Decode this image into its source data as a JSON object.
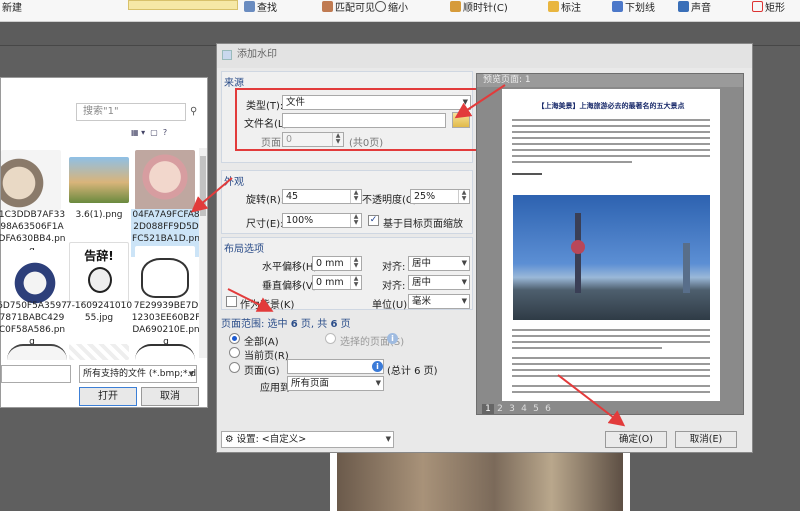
{
  "toolbar": {
    "items": [
      "新建",
      "查找",
      "匹配可见",
      "缩小",
      "顺时针(C)",
      "标注",
      "下划线",
      "声音",
      "矩形"
    ]
  },
  "file_dialog": {
    "search_placeholder": "搜索\"1\"",
    "files": [
      {
        "name": "1C3DDB7AF3398A63506F1ADFA630BB4.png",
        "thumb": "totoro"
      },
      {
        "name": "3.6(1).png",
        "thumb": "dog"
      },
      {
        "name": "04FA7A9FCFA82D088FF9D5DFC521BA1D.png",
        "thumb": "cat"
      },
      {
        "name": "6D750F5A35977871BABC429C0F58A586.png",
        "thumb": "penguin"
      },
      {
        "name": "7-160924101055.jpg",
        "thumb": "meme"
      },
      {
        "name": "7E29939BE7D12303EE60B2FDA690210E.png",
        "thumb": "whitecat"
      }
    ],
    "meme_text": "告辞!",
    "file_type": "所有支持的文件 (*.bmp;*.dib;*",
    "open_button": "打开",
    "cancel_button": "取消"
  },
  "main_dialog": {
    "title": "添加水印",
    "source": {
      "group_title": "来源",
      "type_label": "类型(T):",
      "type_value": "文件",
      "filename_label": "文件名(L):",
      "filename_value": "",
      "page_label": "页面:",
      "page_value": "0",
      "page_total": "(共0页)"
    },
    "appearance": {
      "group_title": "外观",
      "rotation_label": "旋转(R):",
      "rotation_value": "45",
      "opacity_label": "不透明度(C):",
      "opacity_value": "25%",
      "size_label": "尺寸(E):",
      "size_value": "100%",
      "scale_label": "基于目标页面缩放"
    },
    "layout": {
      "group_title": "布局选项",
      "h_offset_label": "水平偏移(H):",
      "h_offset_value": "0 mm",
      "h_align_label": "对齐:",
      "h_align_value": "居中",
      "v_offset_label": "垂直偏移(V):",
      "v_offset_value": "0 mm",
      "v_align_label": "对齐:",
      "v_align_value": "居中",
      "background_label": "作为背景(K)",
      "unit_label": "单位(U):",
      "unit_value": "毫米"
    },
    "page_range": {
      "title_prefix": "页面范围: 选中",
      "selected_count": "6",
      "title_mid": "页, 共",
      "total_count": "6",
      "title_suffix": "页",
      "all_label": "全部(A)",
      "selected_pages_label": "选择的页面(S)",
      "current_page_label": "当前页(R)",
      "pages_label": "页面(G)",
      "pages_total": "(总计 6 页)",
      "apply_label": "应用到:",
      "apply_value": "所有页面"
    },
    "preview": {
      "title": "预览页面: 1",
      "doc_title": "【上海美景】上海旅游必去的最著名的五大景点",
      "page_numbers": [
        "1",
        "2",
        "3",
        "4",
        "5",
        "6"
      ],
      "current_page": "1"
    },
    "settings_label": "设置:",
    "settings_value": "<自定义>",
    "ok_button": "确定(O)",
    "cancel_button": "取消(E)"
  },
  "colors": {
    "annotation_red": "#e23b3b",
    "link_blue": "#2c4e8a"
  }
}
